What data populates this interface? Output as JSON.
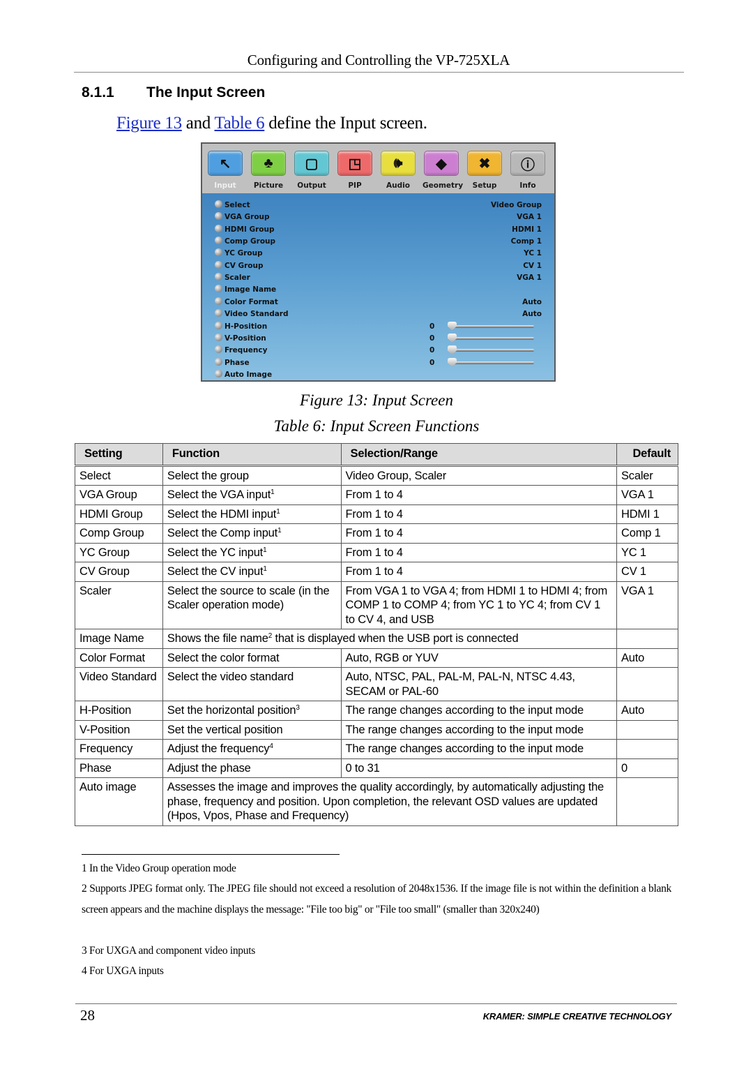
{
  "header": {
    "running_title": "Configuring and Controlling the VP-725XLA"
  },
  "section": {
    "number": "8.1.1",
    "title": "The Input Screen"
  },
  "intro": {
    "link_figure": "Figure 13",
    "text_and": " and ",
    "link_table": "Table 6",
    "text_rest": " define the Input screen."
  },
  "osd": {
    "tabs": [
      {
        "label": "Input",
        "icon": "input-cursor-icon",
        "glyph": "↖",
        "color": "#4f9fe0",
        "active": true
      },
      {
        "label": "Picture",
        "icon": "picture-landscape-icon",
        "glyph": "♣",
        "color": "#7fcf45"
      },
      {
        "label": "Output",
        "icon": "output-monitor-icon",
        "glyph": "▢",
        "color": "#62c7d3"
      },
      {
        "label": "PIP",
        "icon": "pip-window-icon",
        "glyph": "◳",
        "color": "#ee6a6a"
      },
      {
        "label": "Audio",
        "icon": "audio-speaker-icon",
        "glyph": "🕪",
        "color": "#e8df3e"
      },
      {
        "label": "Geometry",
        "icon": "geometry-diamond-icon",
        "glyph": "◆",
        "color": "#cc7fd0"
      },
      {
        "label": "Setup",
        "icon": "setup-tools-icon",
        "glyph": "✖",
        "color": "#f0b531"
      },
      {
        "label": "Info",
        "icon": "info-icon",
        "glyph": "ⓘ",
        "color": "#b8b8b8"
      }
    ],
    "items": [
      {
        "label": "Select",
        "value": "Video Group"
      },
      {
        "label": "VGA Group",
        "value": "VGA 1"
      },
      {
        "label": "HDMI Group",
        "value": "HDMI 1"
      },
      {
        "label": "Comp Group",
        "value": "Comp 1"
      },
      {
        "label": "YC Group",
        "value": "YC 1"
      },
      {
        "label": "CV Group",
        "value": "CV 1"
      },
      {
        "label": "Scaler",
        "value": "VGA 1"
      },
      {
        "label": "Image Name",
        "value": ""
      },
      {
        "label": "Color Format",
        "value": "Auto"
      },
      {
        "label": "Video Standard",
        "value": "Auto"
      },
      {
        "label": "H-Position",
        "number": "0",
        "slider_fraction": 0
      },
      {
        "label": "V-Position",
        "number": "0",
        "slider_fraction": 0
      },
      {
        "label": "Frequency",
        "number": "0",
        "slider_fraction": 0
      },
      {
        "label": "Phase",
        "number": "0",
        "slider_fraction": 0
      },
      {
        "label": "Auto Image",
        "value": ""
      }
    ]
  },
  "figure_caption": "Figure 13: Input Screen",
  "table_caption": "Table 6: Input Screen Functions",
  "table": {
    "headers": [
      "Setting",
      "Function",
      "Selection/Range",
      "Default"
    ],
    "rows": [
      {
        "setting": "Select",
        "function": "Select the group",
        "sup": "",
        "range": "Video Group, Scaler",
        "default": "Scaler"
      },
      {
        "setting": "VGA Group",
        "function": "Select the VGA input",
        "sup": "1",
        "range": "From 1 to 4",
        "default": "VGA 1"
      },
      {
        "setting": "HDMI Group",
        "function": "Select the HDMI input",
        "sup": "1",
        "range": "From 1 to 4",
        "default": "HDMI 1"
      },
      {
        "setting": "Comp Group",
        "function": "Select the Comp input",
        "sup": "1",
        "range": "From 1 to 4",
        "default": "Comp 1"
      },
      {
        "setting": "YC Group",
        "function": "Select the YC input",
        "sup": "1",
        "range": "From 1 to 4",
        "default": "YC 1"
      },
      {
        "setting": "CV Group",
        "function": "Select the CV input",
        "sup": "1",
        "range": "From 1 to 4",
        "default": "CV 1"
      },
      {
        "setting": "Scaler",
        "function": "Select the source to scale (in the Scaler operation mode)",
        "sup": "",
        "range": "From VGA 1 to VGA 4; from HDMI 1 to HDMI 4; from COMP 1 to COMP 4; from YC 1 to YC 4; from CV 1 to CV 4, and USB",
        "default": "VGA 1"
      },
      {
        "setting": "Image Name",
        "function_pre": "Shows the file name",
        "sup": "2",
        "function_post": " that is displayed when the USB port is connected",
        "span": true,
        "default": ""
      },
      {
        "setting": "Color Format",
        "function": "Select the color format",
        "sup": "",
        "range": "Auto, RGB or YUV",
        "default": "Auto"
      },
      {
        "setting": "Video Standard",
        "function": "Select the video standard",
        "sup": "",
        "range": "Auto, NTSC, PAL, PAL-M, PAL-N, NTSC 4.43, SECAM or PAL-60",
        "default": ""
      },
      {
        "setting": "H-Position",
        "function": "Set the horizontal position",
        "sup": "3",
        "range": "The range changes according to the input mode",
        "default": "Auto"
      },
      {
        "setting": "V-Position",
        "function": "Set the vertical position",
        "sup": "",
        "range": "The range changes according to the input mode",
        "default": ""
      },
      {
        "setting": "Frequency",
        "function": "Adjust the frequency",
        "sup": "4",
        "range": "The range changes according to the input mode",
        "default": ""
      },
      {
        "setting": "Phase",
        "function": "Adjust the phase",
        "sup": "",
        "range": "0 to 31",
        "default": "0"
      },
      {
        "setting": "Auto image",
        "function_pre": "Assesses the image and improves the quality accordingly, by automatically adjusting the phase, frequency and position. Upon completion, the relevant OSD values are updated (Hpos, Vpos, Phase and Frequency)",
        "sup": "",
        "function_post": "",
        "span": true,
        "default": ""
      }
    ]
  },
  "footnotes": [
    "1 In the Video Group operation mode",
    "2 Supports JPEG format only. The JPEG file should not exceed a resolution of 2048x1536. If the image file is not within the definition a blank screen appears and the machine displays the message: \"File too big\" or \"File too small\" (smaller than 320x240)",
    "3 For UXGA and component video inputs",
    "4 For UXGA inputs"
  ],
  "footer": {
    "page_number": "28",
    "brand": "KRAMER:  SIMPLE CREATIVE TECHNOLOGY"
  }
}
